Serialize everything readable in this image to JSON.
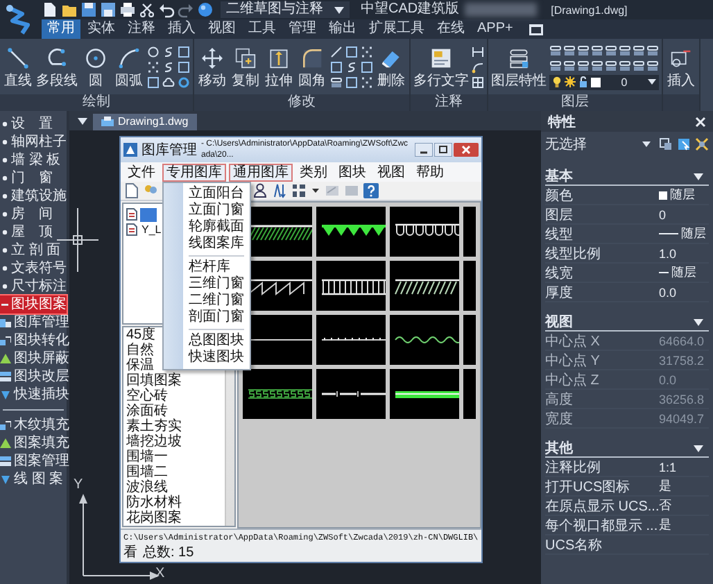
{
  "titlebar": {
    "workspace": "二维草图与注释",
    "app_title": "中望CAD建筑版",
    "document": "[Drawing1.dwg]"
  },
  "menu_tabs": [
    {
      "label": "常用",
      "selected": true
    },
    {
      "label": "实体",
      "selected": false
    },
    {
      "label": "注释",
      "selected": false
    },
    {
      "label": "插入",
      "selected": false
    },
    {
      "label": "视图",
      "selected": false
    },
    {
      "label": "工具",
      "selected": false
    },
    {
      "label": "管理",
      "selected": false
    },
    {
      "label": "输出",
      "selected": false
    },
    {
      "label": "扩展工具",
      "selected": false
    },
    {
      "label": "在线",
      "selected": false
    },
    {
      "label": "APP+",
      "selected": false
    }
  ],
  "ribbon": {
    "groups": [
      {
        "label": "绘制",
        "tools": [
          "直线",
          "多段线",
          "圆",
          "圆弧"
        ]
      },
      {
        "label": "修改",
        "tools": [
          "移动",
          "复制",
          "拉伸",
          "圆角",
          "删除"
        ]
      },
      {
        "label": "注释",
        "tools": [
          "多行文字"
        ]
      },
      {
        "label": "图层",
        "tools": [
          "图层特性"
        ],
        "layer": "0"
      },
      {
        "tools": [
          "插入"
        ]
      }
    ]
  },
  "drawing_tabs": [
    {
      "label": "Drawing1.dwg",
      "selected": true
    }
  ],
  "sidebar": {
    "items": [
      {
        "label": "设　置",
        "selected": false,
        "expanded": false
      },
      {
        "label": "轴网柱子",
        "selected": false,
        "expanded": false
      },
      {
        "label": "墙 梁 板",
        "selected": false,
        "expanded": false
      },
      {
        "label": "门　窗",
        "selected": false,
        "expanded": false
      },
      {
        "label": "建筑设施",
        "selected": false,
        "expanded": false
      },
      {
        "label": "房　间",
        "selected": false,
        "expanded": false
      },
      {
        "label": "屋　顶",
        "selected": false,
        "expanded": false
      },
      {
        "label": "立 剖 面",
        "selected": false,
        "expanded": false
      },
      {
        "label": "文表符号",
        "selected": false,
        "expanded": false
      },
      {
        "label": "尺寸标注",
        "selected": false,
        "expanded": false
      },
      {
        "label": "图块图案",
        "selected": true,
        "expanded": true,
        "children": [
          {
            "label": "图库管理",
            "selected": false
          },
          {
            "label": "图块转化",
            "selected": false
          },
          {
            "label": "图块屏蔽",
            "selected": false
          },
          {
            "label": "图块改层",
            "selected": false
          },
          {
            "label": "快速插块",
            "selected": false
          }
        ]
      }
    ],
    "tools": [
      {
        "label": "木纹填充",
        "selected": false
      },
      {
        "label": "图案填充",
        "selected": false
      },
      {
        "label": "图案管理",
        "selected": false
      },
      {
        "label": "线 图 案",
        "selected": false
      }
    ]
  },
  "dialog": {
    "title": "图库管理",
    "path": "- C:\\Users\\Administrator\\AppData\\Roaming\\ZWSoft\\Zwcada\\20...",
    "menu": [
      {
        "label": "文件",
        "highlighted": false
      },
      {
        "label": "专用图库",
        "highlighted": true
      },
      {
        "label": "通用图库",
        "highlighted": true
      },
      {
        "label": "类别",
        "highlighted": false
      },
      {
        "label": "图块",
        "highlighted": false
      },
      {
        "label": "视图",
        "highlighted": false
      },
      {
        "label": "帮助",
        "highlighted": false
      }
    ],
    "open_menu": {
      "groups": [
        {
          "items": [
            "立面阳台",
            "立面门窗",
            "轮廓截面",
            "线图案库"
          ]
        },
        {
          "items": [
            "栏杆库",
            "三维门窗",
            "二维门窗",
            "剖面门窗"
          ]
        },
        {
          "items": [
            "总图图块",
            "快速图块"
          ]
        }
      ]
    },
    "tree": [
      {
        "selected": true
      },
      {
        "label": "Y_L",
        "selected": false
      }
    ],
    "categories": [
      "45度",
      "自然",
      "保温",
      "回填图案",
      "空心砖",
      "涂面砖",
      "素土夯实",
      "墙挖边坡",
      "围墙一",
      "围墙二",
      "波浪线",
      "防水材料",
      "花岗图案"
    ],
    "thumbnails": [
      {
        "kind": "hatch"
      },
      {
        "kind": "triangles"
      },
      {
        "kind": "loops"
      },
      {
        "kind": "blank"
      },
      {
        "kind": "zigzag"
      },
      {
        "kind": "posts"
      },
      {
        "kind": "diagonal"
      },
      {
        "kind": "blank"
      },
      {
        "kind": "line"
      },
      {
        "kind": "dotted"
      },
      {
        "kind": "wave"
      },
      {
        "kind": "blank"
      },
      {
        "kind": "chain"
      },
      {
        "kind": "dashes"
      },
      {
        "kind": "band"
      },
      {
        "kind": "blank"
      }
    ],
    "status": {
      "path": "C:\\Users\\Administrator\\AppData\\Roaming\\ZWSoft\\Zwcada\\2019\\zh-CN\\DWGLIB\\",
      "path_tail": "看",
      "count": "总数: 15"
    }
  },
  "properties": {
    "title": "特性",
    "selection": "无选择",
    "sections": [
      {
        "title": "基本",
        "expanded": true,
        "rows": [
          {
            "name": "颜色",
            "value": "随层",
            "kind": "color",
            "disabled": false
          },
          {
            "name": "图层",
            "value": "0",
            "kind": "text",
            "disabled": false
          },
          {
            "name": "线型",
            "value": "随层",
            "kind": "linetype",
            "disabled": false
          },
          {
            "name": "线型比例",
            "value": "1.0",
            "kind": "text",
            "disabled": false
          },
          {
            "name": "线宽",
            "value": "随层",
            "kind": "lineweight",
            "disabled": false
          },
          {
            "name": "厚度",
            "value": "0.0",
            "kind": "text",
            "disabled": false
          }
        ]
      },
      {
        "title": "视图",
        "expanded": true,
        "rows": [
          {
            "name": "中心点 X",
            "value": "64664.0",
            "kind": "text",
            "disabled": true
          },
          {
            "name": "中心点 Y",
            "value": "31758.2",
            "kind": "text",
            "disabled": true
          },
          {
            "name": "中心点 Z",
            "value": "0.0",
            "kind": "text",
            "disabled": true
          },
          {
            "name": "高度",
            "value": "36256.8",
            "kind": "text",
            "disabled": true
          },
          {
            "name": "宽度",
            "value": "94049.7",
            "kind": "text",
            "disabled": true
          }
        ]
      },
      {
        "title": "其他",
        "expanded": true,
        "rows": [
          {
            "name": "注释比例",
            "value": "1:1",
            "kind": "text",
            "disabled": false
          },
          {
            "name": "打开UCS图标",
            "value": "是",
            "kind": "text",
            "disabled": false
          },
          {
            "name": "在原点显示 UCS...",
            "value": "否",
            "kind": "text",
            "disabled": false
          },
          {
            "name": "每个视口都显示 ...",
            "value": "是",
            "kind": "text",
            "disabled": false
          },
          {
            "name": "UCS名称",
            "kind": "text",
            "disabled": false
          }
        ]
      }
    ]
  },
  "ucs": {
    "x_label": "X",
    "y_label": "Y"
  }
}
